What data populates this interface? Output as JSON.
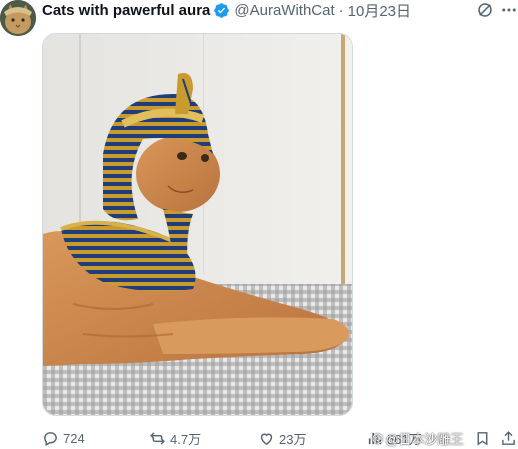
{
  "tweet": {
    "display_name": "Cats with pawerful aura",
    "handle": "@AuraWithCat",
    "separator": "·",
    "date": "10月23日"
  },
  "actions": {
    "replies": "724",
    "reposts": "4.7万",
    "likes": "23万",
    "views": "561万"
  },
  "watermark": {
    "text": "@日本沙雕王"
  },
  "colors": {
    "verified": "#1d9bf0",
    "muted": "#536471",
    "text": "#0f1419"
  },
  "icons": [
    "grok-icon",
    "more-icon",
    "reply-icon",
    "retweet-icon",
    "like-icon",
    "views-icon",
    "bookmark-icon",
    "share-icon",
    "verified-badge-icon"
  ]
}
